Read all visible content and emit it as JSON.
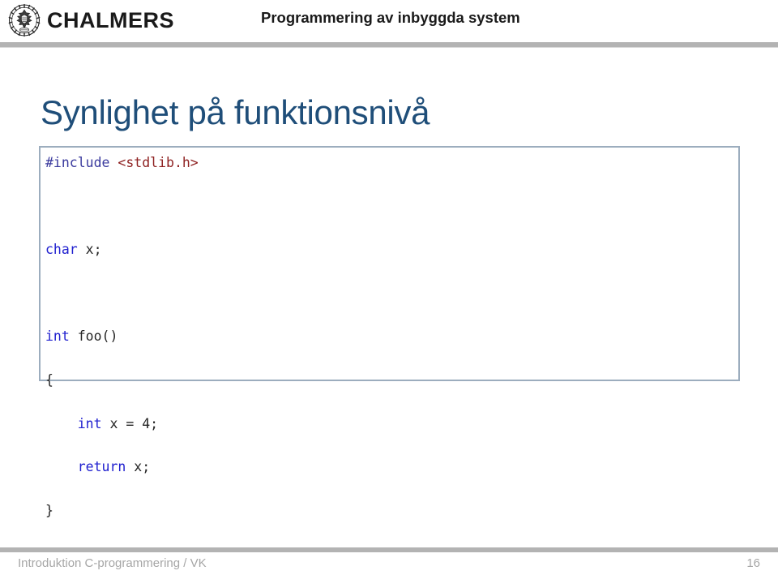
{
  "header": {
    "logo_icon": "chalmers-seal-icon",
    "brand": "CHALMERS",
    "course_title": "Programmering av inbyggda system",
    "rule_color": "#b3b3b3"
  },
  "slide": {
    "title": "Synlighet på funktionsnivå",
    "title_color": "#1F4E79"
  },
  "code_block": {
    "border_color": "#9cadbe",
    "language": "c",
    "lines": [
      [
        {
          "text": "#include ",
          "token": "preprocessor"
        },
        {
          "text": "<stdlib.h>",
          "token": "header-name"
        }
      ],
      [
        {
          "text": "",
          "token": "plain"
        }
      ],
      [
        {
          "text": "char",
          "token": "keyword"
        },
        {
          "text": " x;",
          "token": "plain"
        }
      ],
      [
        {
          "text": "",
          "token": "plain"
        }
      ],
      [
        {
          "text": "int",
          "token": "keyword"
        },
        {
          "text": " foo()",
          "token": "plain"
        }
      ],
      [
        {
          "text": "{",
          "token": "plain"
        }
      ],
      [
        {
          "text": "    ",
          "token": "plain"
        },
        {
          "text": "int",
          "token": "keyword"
        },
        {
          "text": " x = 4;",
          "token": "plain"
        }
      ],
      [
        {
          "text": "    ",
          "token": "plain"
        },
        {
          "text": "return",
          "token": "keyword"
        },
        {
          "text": " x;",
          "token": "plain"
        }
      ],
      [
        {
          "text": "}",
          "token": "plain"
        }
      ]
    ],
    "plain_text": "#include <stdlib.h>\n\nchar x;\n\nint foo()\n{\n    int x = 4;\n    return x;\n}",
    "colors": {
      "preprocessor": "#3b3b9e",
      "header-name": "#8f2222",
      "keyword": "#2020cf",
      "plain": "#262626"
    }
  },
  "footer": {
    "left_text": "Introduktion C-programmering / VK",
    "page_number": "16",
    "rule_color": "#b3b3b3",
    "text_color": "#a6a6a6"
  }
}
